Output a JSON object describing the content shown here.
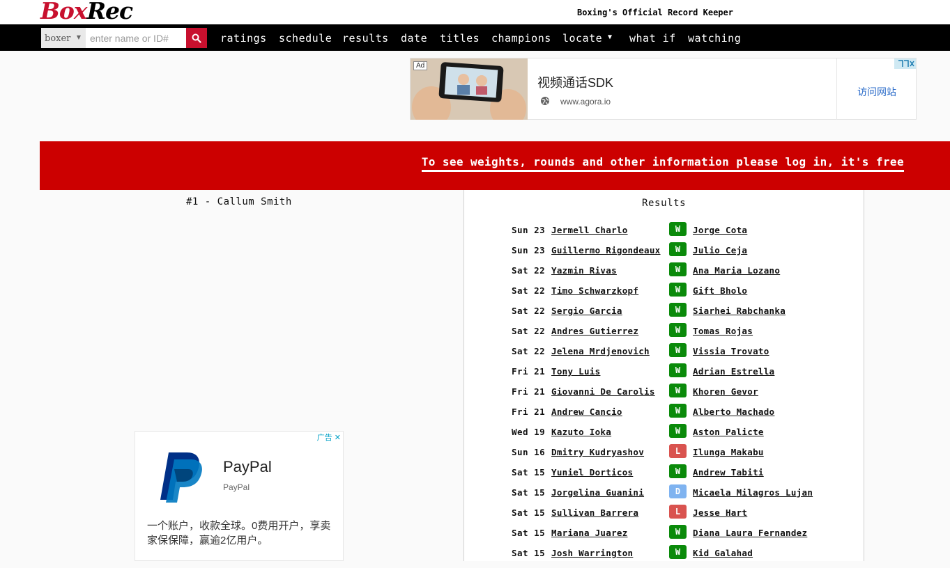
{
  "header": {
    "logo_box": "Box",
    "logo_rec": "Rec",
    "tagline": "Boxing's Official Record Keeper"
  },
  "nav": {
    "type_select": "boxer",
    "search_placeholder": "enter name or ID#",
    "items": [
      "ratings",
      "schedule",
      "results",
      "date",
      "titles",
      "champions",
      "locate",
      "what if",
      "watching"
    ]
  },
  "ad_top": {
    "badge": "Ad",
    "title": "视频通话SDK",
    "url": "www.agora.io",
    "visit": "访问网站"
  },
  "banner": {
    "text": "To see weights, rounds and other information please log in, it's free"
  },
  "left": {
    "rank_title": "#1 - Callum Smith"
  },
  "ad_bottom": {
    "choice": "广告",
    "title": "PayPal",
    "subtitle": "PayPal",
    "body": "一个账户，收款全球。0费用开户，享卖家保保障，赢逾2亿用户。"
  },
  "results": {
    "title": "Results",
    "colors": {
      "W": "#0a8a0a",
      "L": "#d9534f",
      "D": "#7fb3f0"
    },
    "rows": [
      {
        "day": "Sun 23",
        "winner": "Jermell Charlo",
        "result": "W",
        "opponent": "Jorge Cota"
      },
      {
        "day": "Sun 23",
        "winner": "Guillermo Rigondeaux",
        "result": "W",
        "opponent": "Julio Ceja"
      },
      {
        "day": "Sat 22",
        "winner": "Yazmin Rivas",
        "result": "W",
        "opponent": "Ana Maria Lozano"
      },
      {
        "day": "Sat 22",
        "winner": "Timo Schwarzkopf",
        "result": "W",
        "opponent": "Gift Bholo"
      },
      {
        "day": "Sat 22",
        "winner": "Sergio Garcia",
        "result": "W",
        "opponent": "Siarhei Rabchanka"
      },
      {
        "day": "Sat 22",
        "winner": "Andres Gutierrez",
        "result": "W",
        "opponent": "Tomas Rojas"
      },
      {
        "day": "Sat 22",
        "winner": "Jelena Mrdjenovich",
        "result": "W",
        "opponent": "Vissia Trovato"
      },
      {
        "day": "Fri 21",
        "winner": "Tony Luis",
        "result": "W",
        "opponent": "Adrian Estrella"
      },
      {
        "day": "Fri 21",
        "winner": "Giovanni De Carolis",
        "result": "W",
        "opponent": "Khoren Gevor"
      },
      {
        "day": "Fri 21",
        "winner": "Andrew Cancio",
        "result": "W",
        "opponent": "Alberto Machado"
      },
      {
        "day": "Wed 19",
        "winner": "Kazuto Ioka",
        "result": "W",
        "opponent": "Aston Palicte"
      },
      {
        "day": "Sun 16",
        "winner": "Dmitry Kudryashov",
        "result": "L",
        "opponent": "Ilunga Makabu"
      },
      {
        "day": "Sat 15",
        "winner": "Yuniel Dorticos",
        "result": "W",
        "opponent": "Andrew Tabiti"
      },
      {
        "day": "Sat 15",
        "winner": "Jorgelina Guanini",
        "result": "D",
        "opponent": "Micaela Milagros Lujan"
      },
      {
        "day": "Sat 15",
        "winner": "Sullivan Barrera",
        "result": "L",
        "opponent": "Jesse Hart"
      },
      {
        "day": "Sat 15",
        "winner": "Mariana Juarez",
        "result": "W",
        "opponent": "Diana Laura Fernandez"
      },
      {
        "day": "Sat 15",
        "winner": "Josh Warrington",
        "result": "W",
        "opponent": "Kid Galahad"
      }
    ]
  }
}
